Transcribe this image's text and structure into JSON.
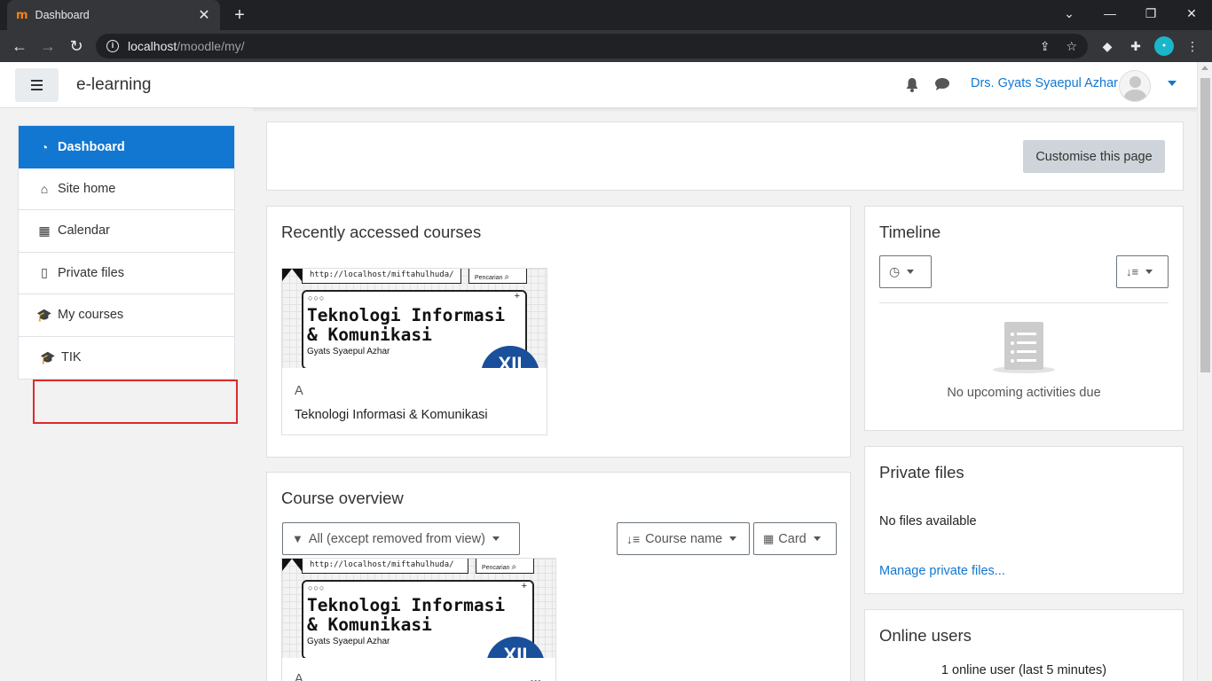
{
  "browser": {
    "tab_title": "Dashboard",
    "favicon": "m",
    "url_host": "localhost",
    "url_path": "/moodle/my/"
  },
  "navbar": {
    "brand": "e-learning",
    "user_name": "Drs. Gyats Syaepul Azhar"
  },
  "nav": {
    "items": [
      {
        "label": "Dashboard",
        "icon": "dashboard-icon",
        "glyph": "◔"
      },
      {
        "label": "Site home",
        "icon": "home-icon",
        "glyph": "⌂"
      },
      {
        "label": "Calendar",
        "icon": "calendar-icon",
        "glyph": "▦"
      },
      {
        "label": "Private files",
        "icon": "file-icon",
        "glyph": "▯"
      },
      {
        "label": "My courses",
        "icon": "graduation-cap-icon",
        "glyph": "🎓"
      },
      {
        "label": "TIK",
        "icon": "graduation-cap-icon",
        "glyph": "🎓"
      }
    ],
    "highlight_color": "#e02a2a"
  },
  "main": {
    "customise_label": "Customise this page",
    "recent": {
      "title": "Recently accessed courses",
      "course": {
        "category": "A",
        "name": "Teknologi Informasi & Komunikasi",
        "image": {
          "url": "http://localhost/miftahulhuda/",
          "search": "Pencarian",
          "title": "Teknologi Informasi\n& Komunikasi",
          "author": "Gyats Syaepul Azhar",
          "badge": "XII"
        }
      }
    },
    "overview": {
      "title": "Course overview",
      "filter_label": "All (except removed from view)",
      "sort_label": "Course name",
      "view_label": "Card",
      "course": {
        "category": "A",
        "image": {
          "url": "http://localhost/miftahulhuda/",
          "search": "Pencarian",
          "title": "Teknologi Informasi\n& Komunikasi",
          "author": "Gyats Syaepul Azhar",
          "badge": "XII"
        }
      }
    }
  },
  "blocks": {
    "timeline": {
      "title": "Timeline",
      "empty_text": "No upcoming activities due"
    },
    "private_files": {
      "title": "Private files",
      "empty_text": "No files available",
      "manage_link": "Manage private files..."
    },
    "online_users": {
      "title": "Online users",
      "summary": "1 online user (last 5 minutes)"
    }
  },
  "colors": {
    "primary": "#1177d1",
    "brand_orange": "#f98012",
    "button_secondary": "#ced4da"
  }
}
